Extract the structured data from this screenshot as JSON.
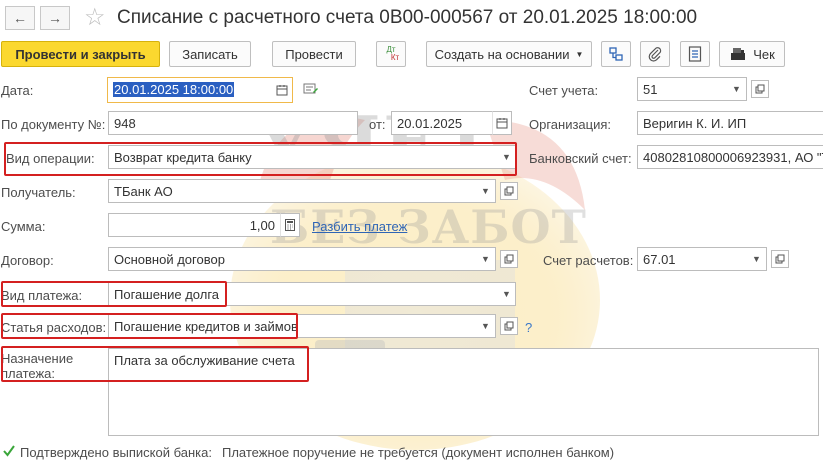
{
  "title": "Списание с расчетного счета 0В00-000567 от 20.01.2025 18:00:00",
  "toolbar": {
    "post_close": "Провести и закрыть",
    "save": "Записать",
    "post": "Провести",
    "dtkt_top": "Дт",
    "dtkt_bottom": "Кт",
    "create_based": "Создать на основании",
    "receipt": "Чек"
  },
  "form": {
    "date_label": "Дата:",
    "date_value": "20.01.2025 18:00:00",
    "account_label": "Счет учета:",
    "account_value": "51",
    "doc_label": "По документу №:",
    "doc_value": "948",
    "from_label": "от:",
    "from_value": "20.01.2025",
    "org_label": "Организация:",
    "org_value": "Веригин К. И. ИП",
    "op_label": "Вид операции:",
    "op_value": "Возврат кредита банку",
    "bank_label": "Банковский счет:",
    "bank_value": "40802810800006923931, АО \"Т",
    "recipient_label": "Получатель:",
    "recipient_value": "ТБанк АО",
    "sum_label": "Сумма:",
    "sum_value": "1,00",
    "split_link": "Разбить платеж",
    "contract_label": "Договор:",
    "contract_value": "Основной договор",
    "settle_label": "Счет расчетов:",
    "settle_value": "67.01",
    "paytype_label": "Вид платежа:",
    "paytype_value": "Погашение долга",
    "expense_label": "Статья расходов:",
    "expense_value": "Погашение кредитов и займов",
    "help": "?",
    "purpose_label_1": "Назначение",
    "purpose_label_2": "платежа:",
    "purpose_value": "Плата за обслуживание счета",
    "confirmed_label": "Подтверждено выпиской банка:",
    "confirmed_value": "Платежное поручение не требуется (документ исполнен банком)"
  },
  "watermark": {
    "line1": "УЧЕТ",
    "line2": "БЕЗ ЗАБОТ"
  },
  "colors": {
    "primary": "#fbd82f",
    "highlight_box": "#d42020",
    "focus": "#f0b94a",
    "link": "#2f65b5",
    "check": "#3aa63a"
  }
}
